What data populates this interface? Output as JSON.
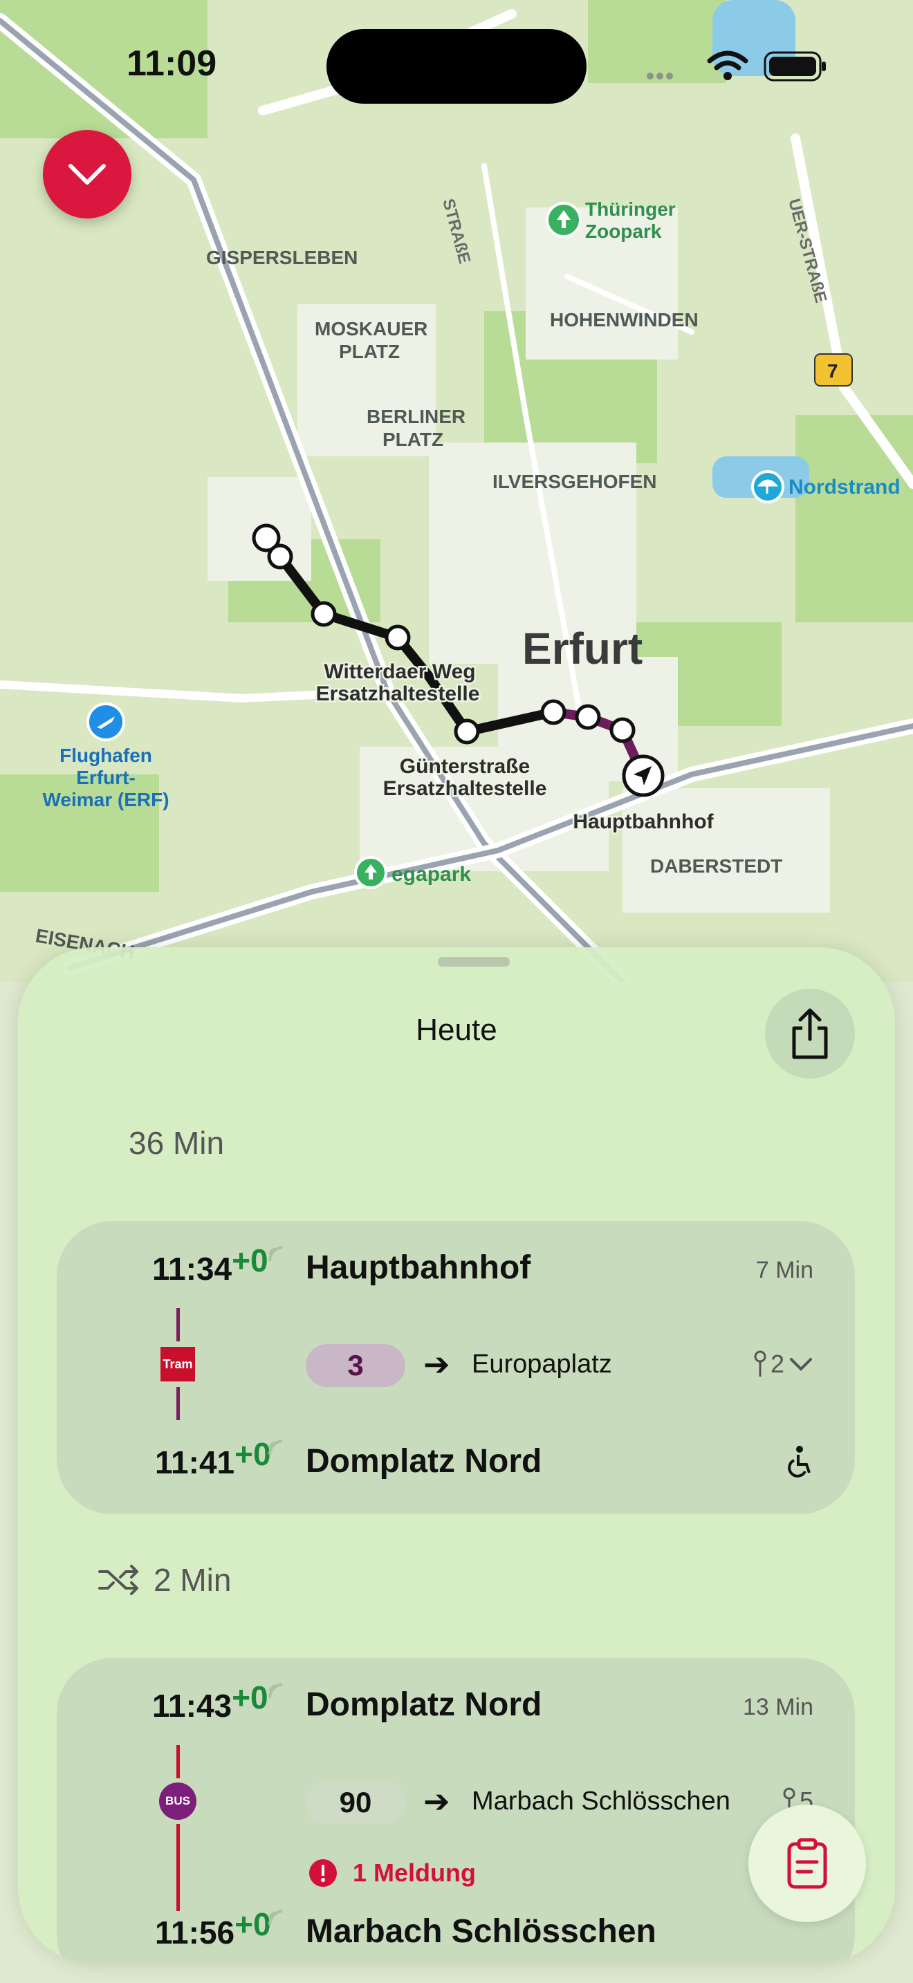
{
  "status_bar": {
    "time": "11:09"
  },
  "map": {
    "places": [
      "GISPERSLEBEN",
      "MOSKAUER",
      "PLATZ",
      "BERLINER",
      "PLATZ",
      "HOHENWINDEN",
      "ILVERSGEHOFEN",
      "DABERSTEDT",
      "EISENACH"
    ],
    "poi": [
      "Thüringer",
      "Zoopark",
      "Nordstrand",
      "egapark"
    ],
    "airport": [
      "Flughafen",
      "Erfurt-",
      "Weimar (ERF)"
    ],
    "city": "Erfurt",
    "stop_labels": [
      "Witterdaer Weg",
      "Ersatzhaltestelle",
      "Günterstraße",
      "Ersatzhaltestelle",
      "Hauptbahnhof"
    ],
    "street_labels": [
      "STRAßE",
      "UER-STRAßE"
    ],
    "road_shield": "7",
    "colors": {
      "route": "#111111",
      "tram_line": "#6b1d5c"
    }
  },
  "sheet": {
    "title": "Heute",
    "total_duration": "36 Min",
    "legs": [
      {
        "dep_time": "11:34",
        "dep_delay": "+0",
        "dep_stop": "Hauptbahnhof",
        "duration": "7 Min",
        "mode": "Tram",
        "line": "3",
        "direction": "Europaplatz",
        "platform": "2",
        "arr_time": "11:41",
        "arr_delay": "+0",
        "arr_stop": "Domplatz Nord",
        "colors": {
          "line_bg": "#c9b6c6",
          "line_fg": "#5a1048",
          "vline": "#7b1f5e",
          "badge": "#c8102e"
        }
      },
      {
        "dep_time": "11:43",
        "dep_delay": "+0",
        "dep_stop": "Domplatz Nord",
        "duration": "13 Min",
        "mode": "BUS",
        "line": "90",
        "direction": "Marbach Schlösschen",
        "platform": "5",
        "notice": "1 Meldung",
        "arr_time": "11:56",
        "arr_delay": "+0",
        "arr_stop": "Marbach Schlösschen",
        "colors": {
          "line_bg": "#cfdcc5",
          "line_fg": "#111111",
          "vline": "#c8102e",
          "badge": "#7b1f7a"
        }
      }
    ],
    "transfer": "2 Min"
  },
  "icons": [
    "chevron-down-icon",
    "share-icon",
    "tram-icon",
    "bus-icon",
    "shuffle-icon",
    "realtime-icon",
    "pin-icon",
    "wheelchair-icon",
    "alert-icon",
    "notes-icon",
    "navigation-arrow-icon",
    "airport-icon",
    "tree-icon",
    "beach-icon"
  ]
}
